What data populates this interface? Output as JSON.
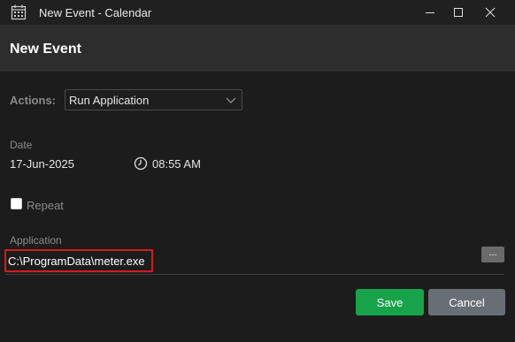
{
  "window": {
    "title": "New Event - Calendar"
  },
  "header": {
    "title": "New Event"
  },
  "actions": {
    "label": "Actions:",
    "selected": "Run Application"
  },
  "date": {
    "label": "Date",
    "value": "17-Jun-2025",
    "time": "08:55 AM"
  },
  "repeat": {
    "label": "Repeat",
    "checked": false
  },
  "application": {
    "label": "Application",
    "value": "C:\\ProgramData\\meter.exe",
    "browse_label": "..."
  },
  "buttons": {
    "save": "Save",
    "cancel": "Cancel"
  },
  "colors": {
    "save": "#16a34a",
    "cancel": "#696e75",
    "highlight": "#d41c1c",
    "header": "#2d2d2d"
  }
}
